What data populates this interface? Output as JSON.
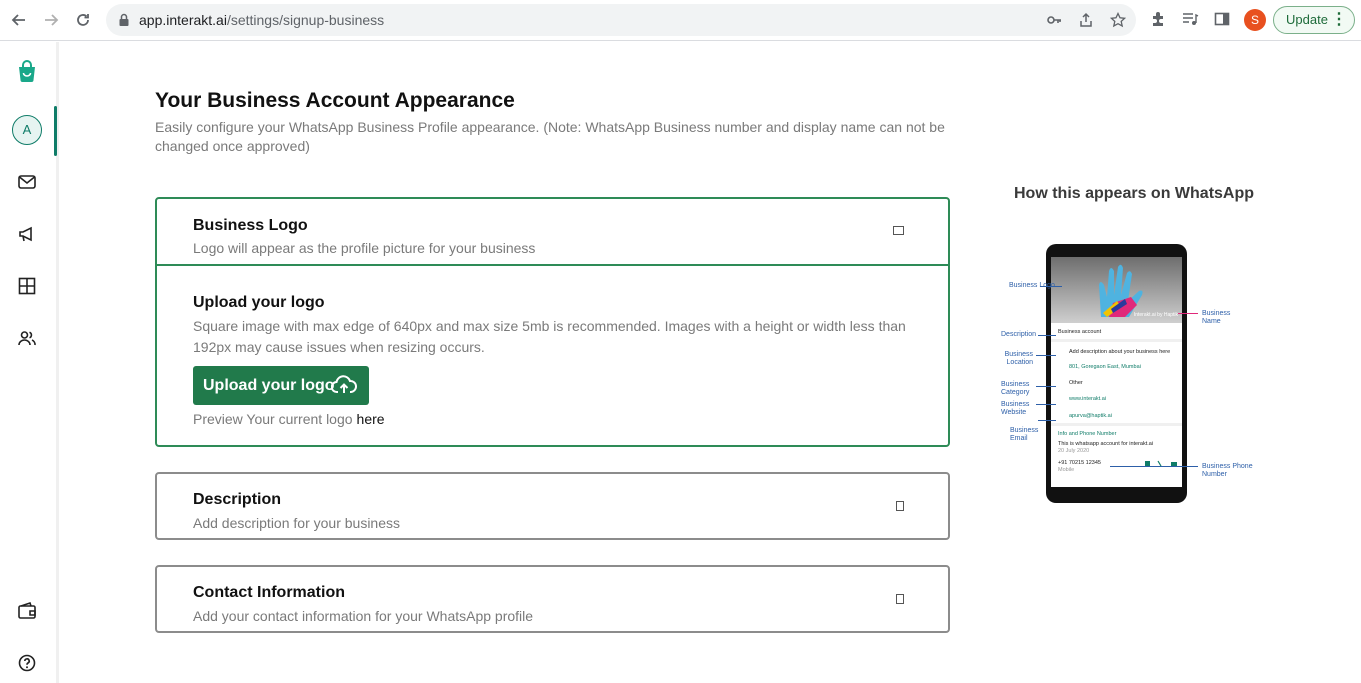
{
  "browser": {
    "url_host": "app.interakt.ai",
    "url_path": "/settings/signup-business",
    "profile_initial": "S",
    "update_label": "Update",
    "update_menu_glyph": "⋮"
  },
  "sidebar": {
    "avatar_initial": "A",
    "items": [
      "logo-icon",
      "avatar",
      "inbox-icon",
      "campaign-icon",
      "grid-icon",
      "users-icon",
      "wallet-icon",
      "help-icon"
    ]
  },
  "page": {
    "title": "Your Business Account Appearance",
    "subtitle": "Easily configure your WhatsApp Business Profile appearance. (Note: WhatsApp Business number and display name can not be changed once approved)"
  },
  "sections": {
    "logo": {
      "title": "Business Logo",
      "subtitle": "Logo will appear as the profile picture for your business",
      "upload_title": "Upload your logo",
      "upload_desc": "Square image with max edge of 640px and max size 5mb is recommended. Images with a height or width less than 192px may cause issues when resizing occurs.",
      "upload_button": "Upload your logo",
      "preview_text": "Preview Your current logo",
      "preview_link": "here"
    },
    "description": {
      "title": "Description",
      "subtitle": "Add description for your business"
    },
    "contact": {
      "title": "Contact Information",
      "subtitle": "Add your contact information for your WhatsApp profile"
    }
  },
  "whatsapp_preview": {
    "title": "How this appears on WhatsApp",
    "profile_name": "Interakt.ai by Haptik",
    "account_type": "Business account",
    "description": "Add description about your business here",
    "location": "801, Goregaon East, Mumbai",
    "category": "Other",
    "website": "www.interakt.ai",
    "email": "apurva@haptik.ai",
    "info_heading": "Info and Phone Number",
    "info_text": "This is whatsapp account for interakt.ai",
    "info_date": "20 July 2020",
    "phone": "+91 70215 12345",
    "phone_type": "Mobile",
    "callouts": {
      "logo": "Business Logo",
      "name": "Business Name",
      "description": "Description",
      "location": "Business Location",
      "category": "Business Category",
      "website": "Business Website",
      "email": "Business Email",
      "phone": "Business Phone Number"
    }
  },
  "colors": {
    "brand": "#217a4b",
    "accent": "#0f7c68",
    "open_border": "#2e8b57",
    "callout": "#2d5fa8"
  }
}
